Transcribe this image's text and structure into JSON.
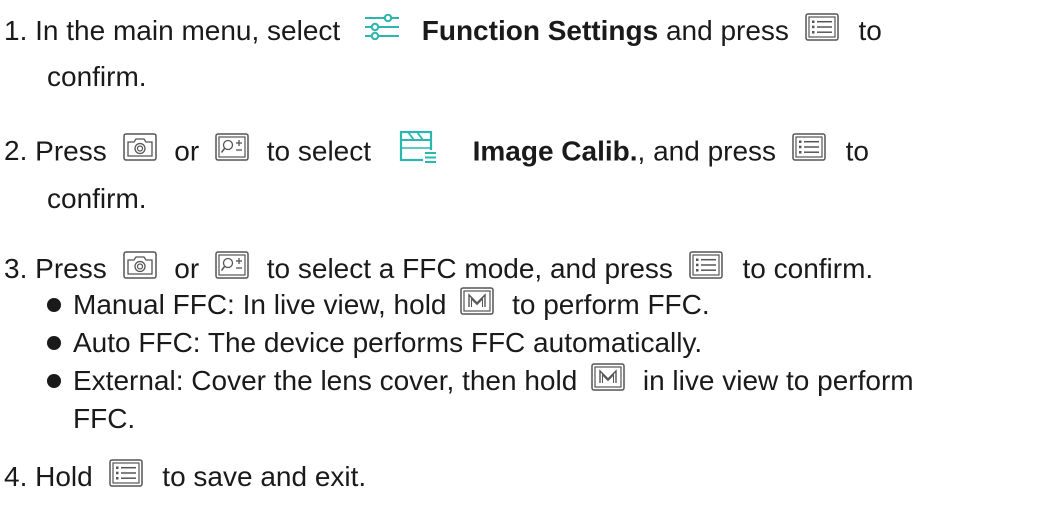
{
  "colors": {
    "accent": "#2bb7b0",
    "text": "#1a1a1a"
  },
  "steps": [
    {
      "number": "1.",
      "line1": {
        "a": "In the main menu, select",
        "menu_icon": "sliders-icon",
        "strong": "Function Settings",
        "b": "and press",
        "confirm_icon": "menu-button-icon",
        "c": "to"
      },
      "line2": "confirm."
    },
    {
      "number": "2.",
      "line1": {
        "a": "Press",
        "icon1": "camera-button-icon",
        "or": "or",
        "icon2": "zoom-button-icon",
        "b": "to select",
        "menu_icon": "image-calib-icon",
        "strong": "Image Calib.",
        "c": ", and press",
        "confirm_icon": "menu-button-icon",
        "d": "to"
      },
      "line2": "confirm."
    },
    {
      "number": "3.",
      "line1": {
        "a": "Press",
        "icon1": "camera-button-icon",
        "or": "or",
        "icon2": "zoom-button-icon",
        "b": "to select a FFC mode, and press",
        "confirm_icon": "menu-button-icon",
        "c": "to confirm."
      },
      "bullets": [
        {
          "a": "Manual FFC: In live view, hold",
          "icon": "m-button-icon",
          "b": "to perform FFC."
        },
        {
          "a": "Auto FFC: The device performs FFC automatically."
        },
        {
          "a": "External: Cover the lens cover, then hold",
          "icon": "m-button-icon",
          "b": "in live view to perform",
          "cont": "FFC."
        }
      ]
    },
    {
      "number": "4.",
      "line1": {
        "a": "Hold",
        "confirm_icon": "menu-button-icon",
        "b": "to save and exit."
      }
    }
  ]
}
